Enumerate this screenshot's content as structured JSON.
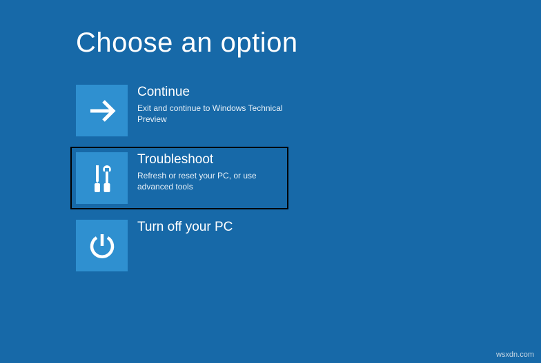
{
  "title": "Choose an option",
  "options": [
    {
      "icon": "arrow-right",
      "title": "Continue",
      "description": "Exit and continue to Windows Technical Preview"
    },
    {
      "icon": "tools",
      "title": "Troubleshoot",
      "description": "Refresh or reset your PC, or use advanced tools",
      "highlighted": true
    },
    {
      "icon": "power",
      "title": "Turn off your PC",
      "description": ""
    }
  ],
  "watermark": "wsxdn.com"
}
